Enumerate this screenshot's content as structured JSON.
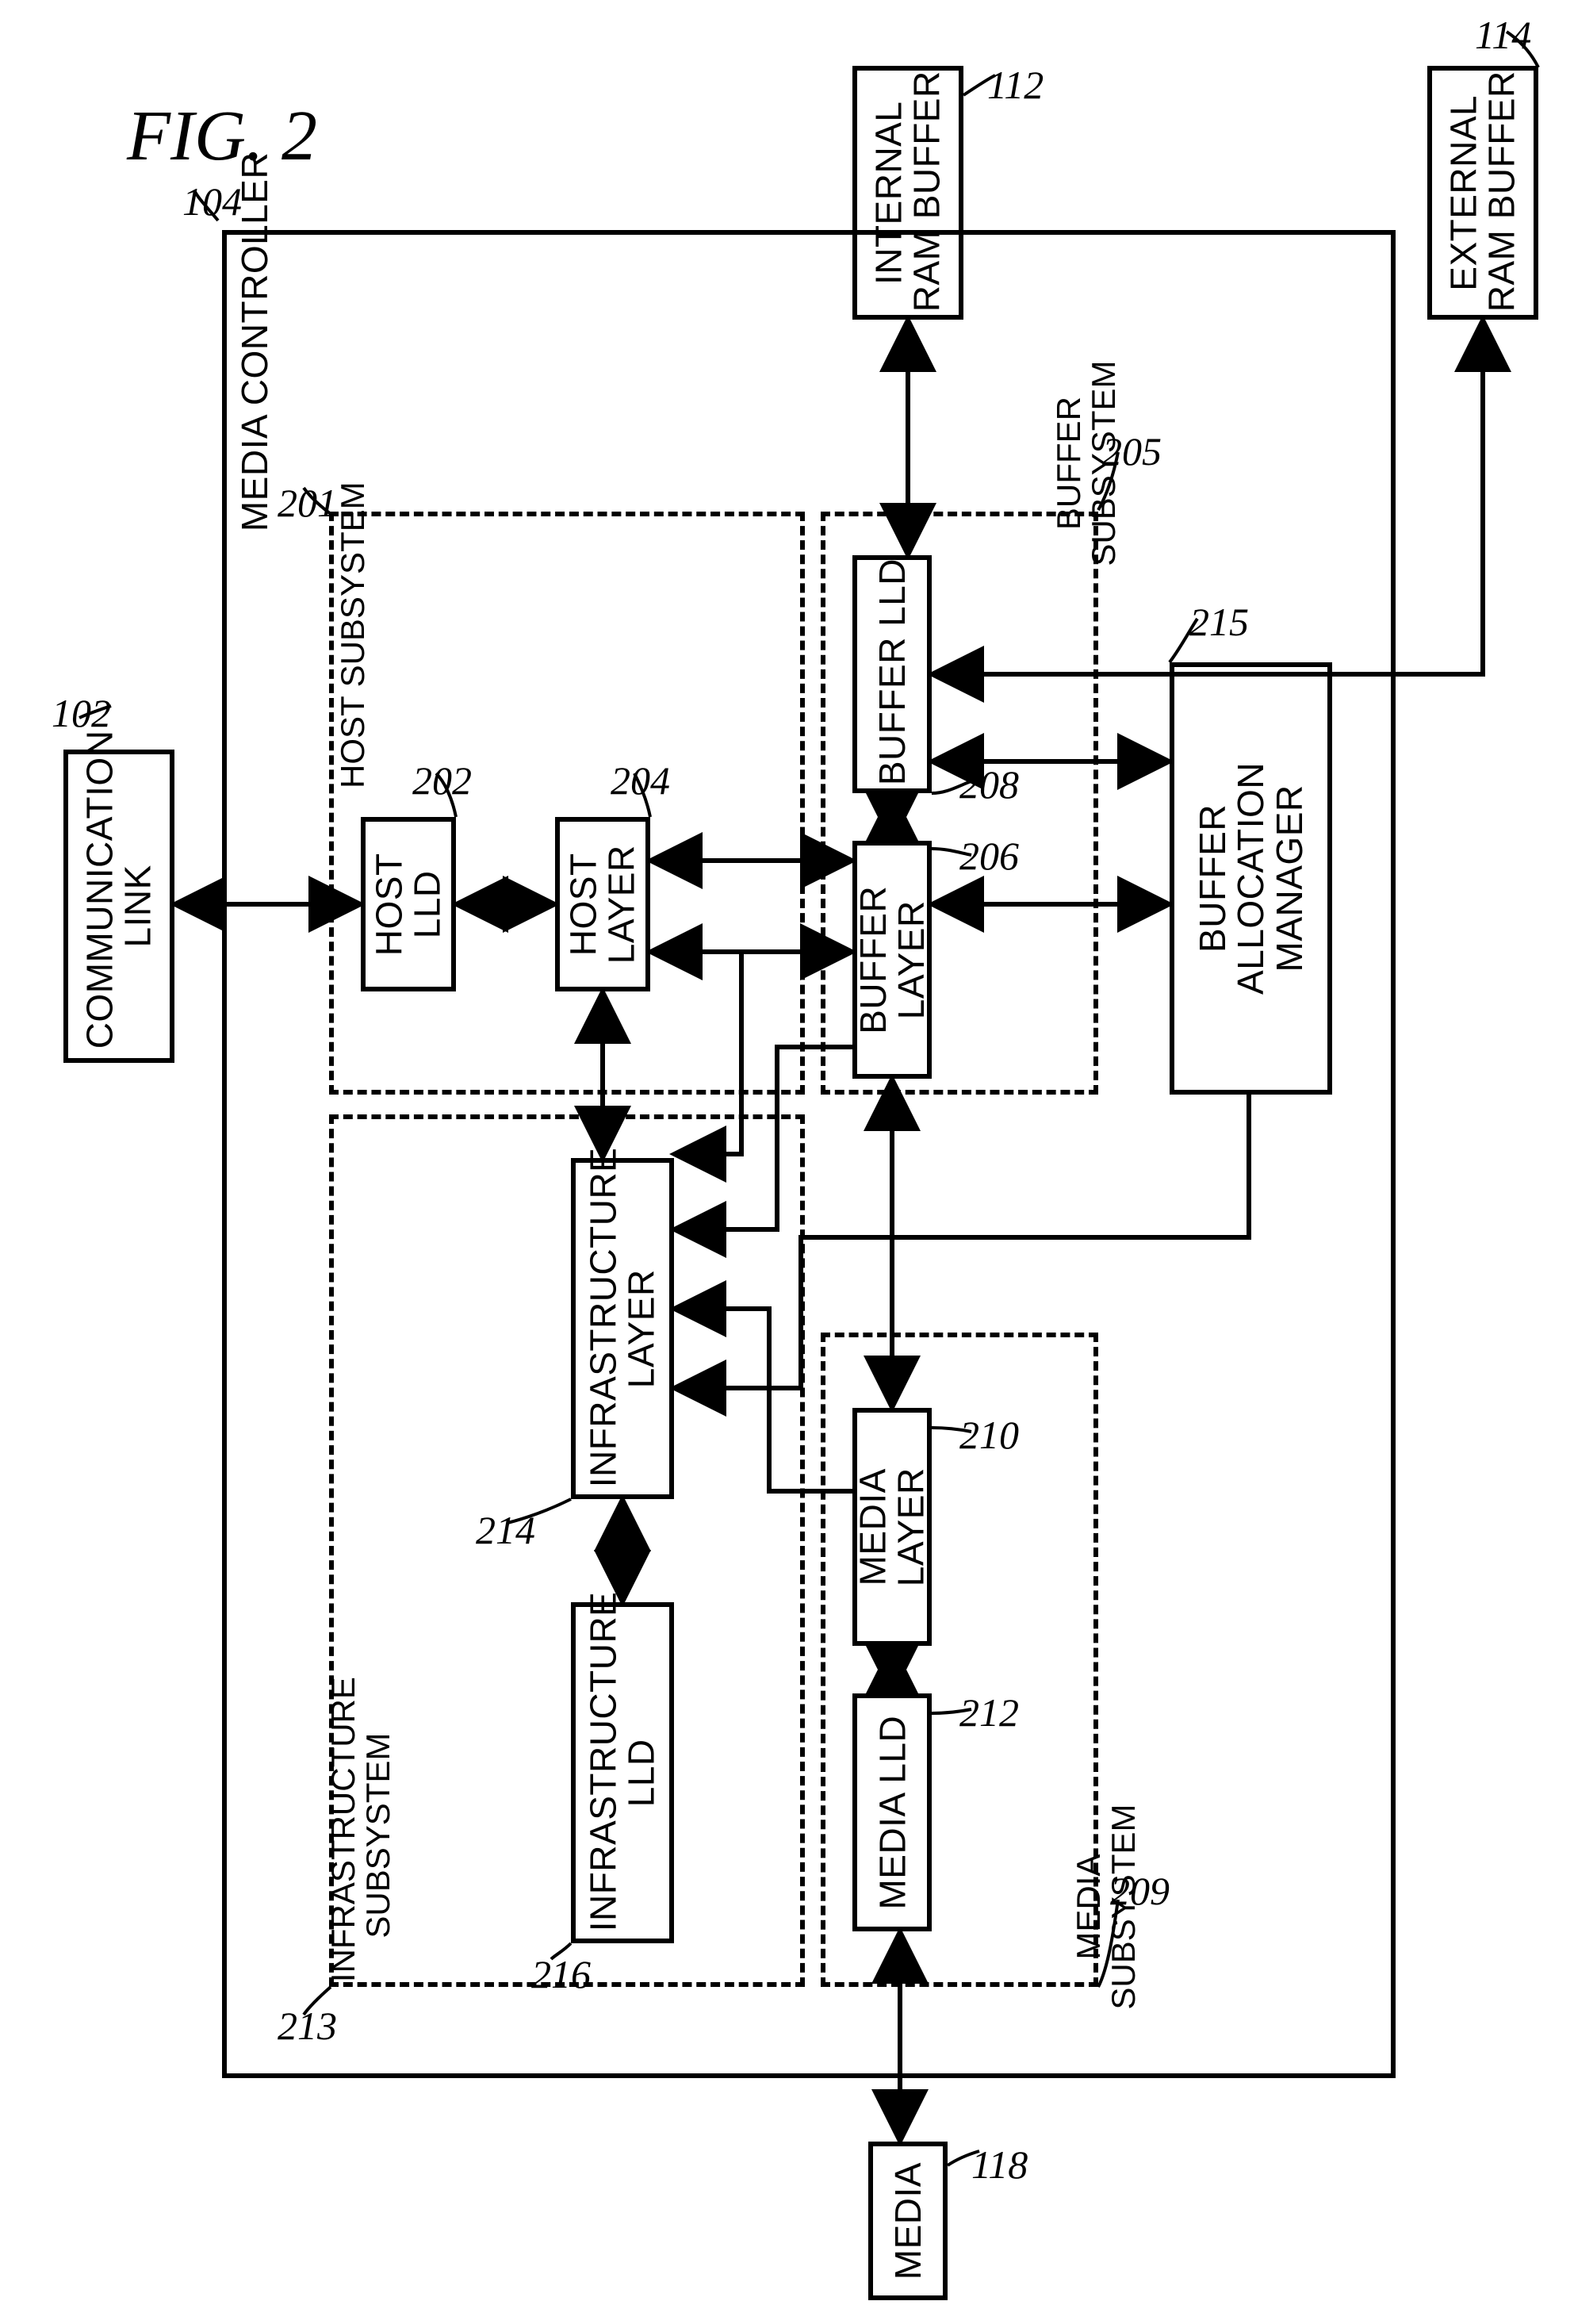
{
  "figure_title": "FIG. 2",
  "media_controller": {
    "label": "MEDIA CONTROLLER",
    "ref": "104"
  },
  "host_subsystem": {
    "label": "HOST SUBSYSTEM",
    "ref": "201"
  },
  "buffer_subsystem": {
    "label": "BUFFER\nSUBSYSTEM",
    "ref": "205"
  },
  "media_subsystem": {
    "label": "MEDIA\nSUBSYSTEM",
    "ref": "209"
  },
  "infrastructure_subsystem": {
    "label": "INFRASTRUCTURE\nSUBSYSTEM",
    "ref": "213"
  },
  "communication_link": {
    "label": "COMMUNICATION\nLINK",
    "ref": "102"
  },
  "internal_ram_buffer": {
    "label": "INTERNAL\nRAM BUFFER",
    "ref": "112"
  },
  "external_ram_buffer": {
    "label": "EXTERNAL\nRAM BUFFER",
    "ref": "114"
  },
  "media_external": {
    "label": "MEDIA",
    "ref": "118"
  },
  "host_lld": {
    "label": "HOST\nLLD",
    "ref": "202"
  },
  "host_layer": {
    "label": "HOST\nLAYER",
    "ref": "204"
  },
  "buffer_lld": {
    "label": "BUFFER LLD",
    "ref": "208"
  },
  "buffer_layer": {
    "label": "BUFFER\nLAYER",
    "ref": "206"
  },
  "buffer_alloc_mgr": {
    "label": "BUFFER\nALLOCATION\nMANAGER",
    "ref": "215"
  },
  "media_layer": {
    "label": "MEDIA\nLAYER",
    "ref": "210"
  },
  "media_lld": {
    "label": "MEDIA LLD",
    "ref": "212"
  },
  "infra_layer": {
    "label": "INFRASTRUCTURE\nLAYER",
    "ref": "214"
  },
  "infra_lld": {
    "label": "INFRASTRUCTURE\nLLD",
    "ref": "216"
  }
}
